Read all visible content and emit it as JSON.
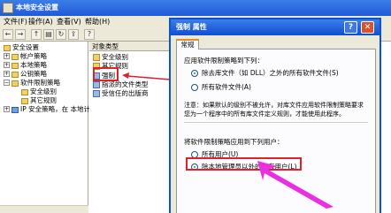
{
  "main_window": {
    "title": "本地安全设置",
    "menu": [
      "文件(F)",
      "操作(A)",
      "查看(V)",
      "帮助(H)"
    ],
    "toolbar_icons": [
      "back-icon",
      "forward-icon",
      "up-icon",
      "properties-icon",
      "refresh-icon",
      "export-icon",
      "help-icon"
    ]
  },
  "tree": {
    "items": [
      {
        "label": "安全设置",
        "icon": "security-icon"
      },
      {
        "label": "帐户策略",
        "icon": "folder-icon"
      },
      {
        "label": "本地策略",
        "icon": "folder-icon"
      },
      {
        "label": "公钥策略",
        "icon": "folder-icon"
      },
      {
        "label": "软件限制策略",
        "icon": "folder-icon"
      },
      {
        "label": "安全级别",
        "icon": "folder-icon"
      },
      {
        "label": "其它规则",
        "icon": "folder-icon"
      },
      {
        "label": "IP 安全策略，在 本地计",
        "icon": "ip-policy-icon"
      }
    ]
  },
  "list": {
    "column_header": "对象类型",
    "items": [
      {
        "label": "安全级别"
      },
      {
        "label": "其它规则"
      },
      {
        "label": "强制"
      },
      {
        "label": "指派的文件类型"
      },
      {
        "label": "受信任的出版商"
      }
    ]
  },
  "dialog": {
    "title": "强制 属性",
    "help_glyph": "?",
    "close_glyph": "✕",
    "tab_label": "常规",
    "apply_to_label": "应用软件限制策略到下列：",
    "option_except_libraries": "除去库文件（如 DLL）之外的所有软件文件(S)",
    "option_all_files": "所有软件文件(A)",
    "note_line1": "注意：如果默认的级别不被允许，对库文件应用软件限制策略要求",
    "note_line2": "您为一个程序中的所有库文件定义规则，才能使用此程序。",
    "apply_users_label": "将软件限制策略应用到下列用户：",
    "option_all_users": "所有用户(U)",
    "option_except_admins": "除本地管理员以外的所有用户(L)"
  },
  "colors": {
    "title_blue": "#1f5ad8",
    "annotation_red": "#e0202d",
    "annotation_magenta": "#ea2fe0",
    "window_face": "#ece9d8"
  }
}
